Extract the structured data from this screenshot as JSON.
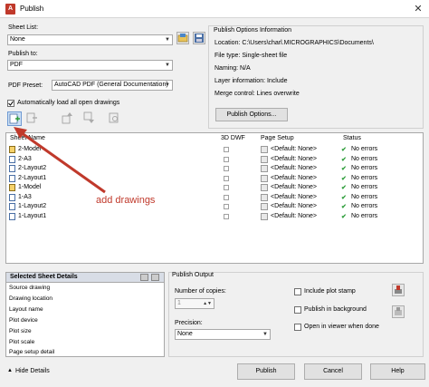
{
  "window": {
    "title": "Publish",
    "app_icon": "autocad-icon",
    "close_label": "✕"
  },
  "sheet_list": {
    "label": "Sheet List:",
    "value": "None"
  },
  "publish_to": {
    "label": "Publish to:",
    "value": "PDF"
  },
  "pdf_preset": {
    "label": "PDF Preset:",
    "value": "AutoCAD PDF (General Documentation)"
  },
  "auto_load": {
    "label": "Automatically load all open drawings",
    "checked": true
  },
  "publish_options_info": {
    "heading": "Publish Options Information",
    "location": "Location: C:\\Users\\charl.MICROGRAPHICS\\Documents\\",
    "file_type": "File type: Single-sheet file",
    "naming": "Naming: N/A",
    "layer_info": "Layer information: Include",
    "merge_control": "Merge control: Lines overwrite",
    "button": "Publish Options..."
  },
  "table": {
    "headers": {
      "sheet_name": "Sheet Name",
      "dwf": "3D DWF",
      "page_setup": "Page Setup",
      "status": "Status"
    },
    "rows": [
      {
        "name": "2-Model",
        "kind": "model",
        "page_setup": "<Default: None>",
        "status": "No errors"
      },
      {
        "name": "2-A3",
        "kind": "layout",
        "page_setup": "<Default: None>",
        "status": "No errors"
      },
      {
        "name": "2-Layout2",
        "kind": "layout",
        "page_setup": "<Default: None>",
        "status": "No errors"
      },
      {
        "name": "2-Layout1",
        "kind": "layout",
        "page_setup": "<Default: None>",
        "status": "No errors"
      },
      {
        "name": "1-Model",
        "kind": "model",
        "page_setup": "<Default: None>",
        "status": "No errors"
      },
      {
        "name": "1-A3",
        "kind": "layout",
        "page_setup": "<Default: None>",
        "status": "No errors"
      },
      {
        "name": "1-Layout2",
        "kind": "layout",
        "page_setup": "<Default: None>",
        "status": "No errors"
      },
      {
        "name": "1-Layout1",
        "kind": "layout",
        "page_setup": "<Default: None>",
        "status": "No errors"
      }
    ]
  },
  "annotation": {
    "text": "add drawings",
    "color": "#c0392b"
  },
  "selected_sheet_details": {
    "heading": "Selected Sheet Details",
    "items": [
      "Source drawing",
      "Drawing location",
      "Layout name",
      "Plot device",
      "Plot size",
      "Plot scale",
      "Page setup detail"
    ]
  },
  "publish_output": {
    "heading": "Publish Output",
    "copies_label": "Number of copies:",
    "copies_value": "1",
    "precision_label": "Precision:",
    "precision_value": "None",
    "include_plot_stamp": "Include plot stamp",
    "publish_in_background": "Publish in background",
    "open_in_viewer": "Open in viewer when done"
  },
  "footer": {
    "hide_details": "Hide Details",
    "publish": "Publish",
    "cancel": "Cancel",
    "help": "Help"
  },
  "colors": {
    "status_ok": "#2e9d3a",
    "arrow": "#c0392b",
    "accent": "#0078d7"
  }
}
